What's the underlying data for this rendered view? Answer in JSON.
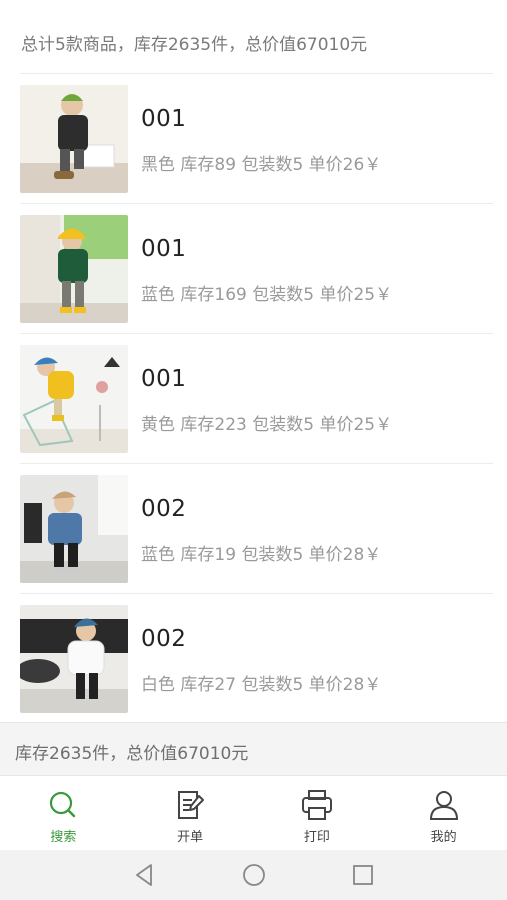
{
  "summary_top": "总计5款商品，库存2635件，总价值67010元",
  "products": [
    {
      "code": "001",
      "desc": "黑色 库存89 包装数5 单价26￥",
      "image": "child-black-jacket-photo"
    },
    {
      "code": "001",
      "desc": "蓝色 库存169 包装数5 单价25￥",
      "image": "child-green-jacket-photo"
    },
    {
      "code": "001",
      "desc": "黄色 库存223 包装数5 单价25￥",
      "image": "child-yellow-jacket-photo"
    },
    {
      "code": "002",
      "desc": "蓝色 库存19 包装数5 单价28￥",
      "image": "child-denim-jacket-photo"
    },
    {
      "code": "002",
      "desc": "白色 库存27 包装数5 单价28￥",
      "image": "child-white-coat-photo"
    }
  ],
  "summary_bottom": "库存2635件，总价值67010元",
  "tabs": [
    {
      "label": "搜索",
      "icon": "search-icon",
      "active": true
    },
    {
      "label": "开单",
      "icon": "edit-document-icon",
      "active": false
    },
    {
      "label": "打印",
      "icon": "printer-icon",
      "active": false
    },
    {
      "label": "我的",
      "icon": "user-icon",
      "active": false
    }
  ],
  "nav": [
    "back-triangle-icon",
    "home-circle-icon",
    "recent-square-icon"
  ],
  "colors": {
    "accent": "#3a9a3a",
    "text_muted": "#9a9a9a",
    "summary_bg": "#f4f4f4"
  }
}
